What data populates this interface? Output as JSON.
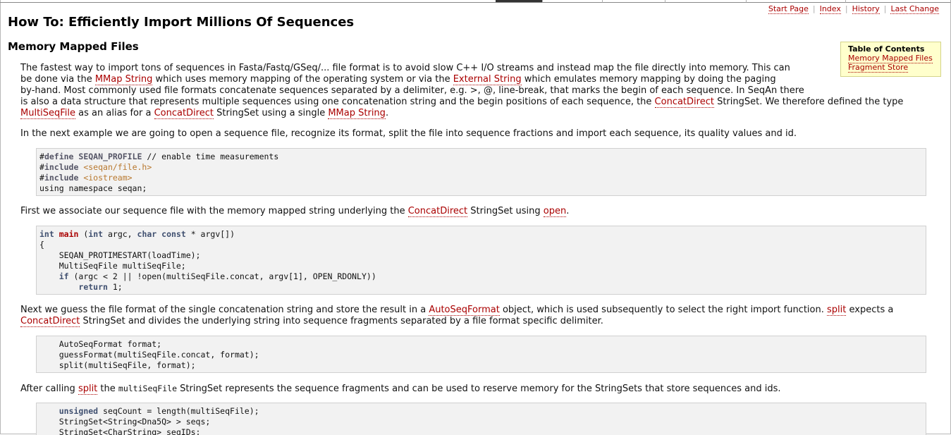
{
  "nav": {
    "start_page": "Start Page",
    "index": "Index",
    "history": "History",
    "last_change": "Last Change"
  },
  "page": {
    "title": "How To: Efficiently Import Millions Of Sequences",
    "section_title": "Memory Mapped Files"
  },
  "toc": {
    "title": "Table of Contents",
    "items": [
      "Memory Mapped Files",
      "Fragment Store"
    ]
  },
  "p1": {
    "l1": "The fastest way to import tons of sequences in Fasta/Fastq/GSeq/... file format is to avoid slow C++ I/O streams and instead map the file directly into memory. This can",
    "l2a": "be done via the ",
    "link_mmap": "MMap String",
    "l2b": " which uses memory mapping of the operating system or via the ",
    "link_external": "External String",
    "l2c": " which emulates memory mapping by doing the paging",
    "l3": "by-hand. Most commonly used file formats concatenate sequences separated by a delimiter, e.g. >, @, line-break, that marks the begin of each sequence. In SeqAn there",
    "l4a": "is also a data structure that represents multiple sequences using one concatenation string and the begin positions of each sequence, the ",
    "link_concat": "ConcatDirect",
    "l4b": " StringSet. We therefore defined the type",
    "link_multiseq": "MultiSeqFile",
    "l5a": " as an alias for a ",
    "link_concat2": "ConcatDirect",
    "l5b": " StringSet using a single ",
    "link_mmap2": "MMap String",
    "l5c": "."
  },
  "p2": {
    "text": "In the next example we are going to open a sequence file, recognize its format, split the file into sequence fractions and import each sequence, its quality values and id."
  },
  "code1": {
    "l1a": "#",
    "l1b": "define",
    "l1c": " SEQAN_PROFILE",
    "l1d": " // enable time measurements",
    "l2a": "#",
    "l2b": "include",
    "l2c": " <seqan/file.h>",
    "l3a": "#",
    "l3b": "include",
    "l3c": " <iostream>",
    "l4": "using namespace seqan;"
  },
  "p3": {
    "a": "First we associate our sequence file with the memory mapped string underlying the ",
    "link_concat": "ConcatDirect",
    "b": " StringSet using ",
    "link_open": "open",
    "c": "."
  },
  "code2": {
    "int": "int",
    "main": "main",
    "paren": " (",
    "int2": "int",
    "argc": " argc, ",
    "char": "char",
    "const": " const",
    "argv": " * argv[])",
    "brace": "{",
    "l3": "    SEQAN_PROTIMESTART(loadTime);",
    "l4": "    MultiSeqFile multiSeqFile;",
    "if_indent": "    ",
    "if": "if",
    "l5": " (argc < 2 || !open(multiSeqFile.concat, argv[1], OPEN_RDONLY))",
    "ret_indent": "        ",
    "return": "return",
    "l6": " 1;"
  },
  "p4": {
    "a": "Next we guess the file format of the single concatenation string and store the result in a ",
    "link_auto": "AutoSeqFormat",
    "b": " object, which is used subsequently to select the right import function. ",
    "link_split": "split",
    "c": " expects a",
    "link_concat": "ConcatDirect",
    "d": " StringSet and divides the underlying string into sequence fragments separated by a file format specific delimiter."
  },
  "code3": {
    "l1": "    AutoSeqFormat format;",
    "l2": "    guessFormat(multiSeqFile.concat, format);",
    "l3": "    split(multiSeqFile, format);"
  },
  "p5": {
    "a": "After calling ",
    "link_split": "split",
    "b": " the ",
    "mono": "multiSeqFile",
    "c": " StringSet represents the sequence fragments and can be used to reserve memory for the StringSets that store sequences and ids."
  },
  "code4": {
    "indent": "    ",
    "unsigned": "unsigned",
    "l1": " seqCount = length(multiSeqFile);",
    "l2": "    StringSet<String<Dna5Q> > seqs;",
    "l3": "    StringSet<CharString> seqIDs;"
  }
}
